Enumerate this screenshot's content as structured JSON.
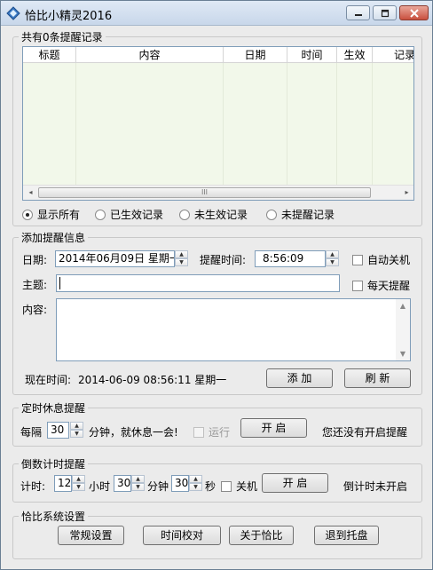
{
  "window": {
    "title": "恰比小精灵2016"
  },
  "records": {
    "legend": "共有0条提醒记录",
    "columns": [
      "标题",
      "内容",
      "日期",
      "时间",
      "生效",
      "记录"
    ],
    "scroll_left": "◂",
    "scroll_right": "▸",
    "thumb_grip": "III",
    "filters": [
      {
        "label": "显示所有",
        "selected": true
      },
      {
        "label": "已生效记录",
        "selected": false
      },
      {
        "label": "未生效记录",
        "selected": false
      },
      {
        "label": "未提醒记录",
        "selected": false
      }
    ]
  },
  "add": {
    "legend": "添加提醒信息",
    "date_label": "日期:",
    "date_value": "2014年06月09日  星期一",
    "time_label": "提醒时间:",
    "time_value": "8:56:09",
    "auto_shutdown": "自动关机",
    "subject_label": "主题:",
    "subject_value": "",
    "daily_remind": "每天提醒",
    "content_label": "内容:",
    "now_label": "现在时间:",
    "now_value": "2014-06-09 08:56:11 星期一",
    "add_button": "添  加",
    "refresh_button": "刷  新"
  },
  "rest": {
    "legend": "定时休息提醒",
    "every_label": "每隔",
    "minutes_value": "30",
    "desc": "分钟，就休息一会!",
    "run_label": "运行",
    "start_button": "开  启",
    "status": "您还没有开启提醒"
  },
  "countdown": {
    "legend": "倒数计时提醒",
    "timer_label": "计时:",
    "hours_value": "12",
    "hours_unit": "小时",
    "minutes_value": "30",
    "minutes_unit": "分钟",
    "seconds_value": "30",
    "seconds_unit": "秒",
    "shutdown_label": "关机",
    "start_button": "开  启",
    "status": "倒计时未开启"
  },
  "settings": {
    "legend": "恰比系统设置",
    "buttons": [
      "常规设置",
      "时间校对",
      "关于恰比",
      "退到托盘"
    ]
  }
}
